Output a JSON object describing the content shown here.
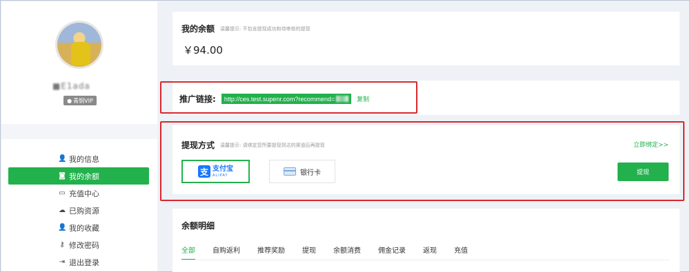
{
  "user": {
    "name": "■E1ada",
    "vip_label": "青铜VIP"
  },
  "sidebar": {
    "items": [
      {
        "label": "我的信息",
        "icon": "user-icon",
        "glyph": "👤"
      },
      {
        "label": "我的余额",
        "icon": "wallet-icon",
        "glyph": "◙",
        "active": true
      },
      {
        "label": "充值中心",
        "icon": "credit-card-icon",
        "glyph": "▭"
      },
      {
        "label": "已购资源",
        "icon": "cloud-download-icon",
        "glyph": "☁"
      },
      {
        "label": "我的收藏",
        "icon": "user-star-icon",
        "glyph": "👤"
      },
      {
        "label": "修改密码",
        "icon": "key-icon",
        "glyph": "⚷"
      },
      {
        "label": "退出登录",
        "icon": "logout-icon",
        "glyph": "⇥"
      }
    ]
  },
  "balance": {
    "title": "我的余额",
    "tip": "温馨提示: 不包含提现成功和待审核的提现",
    "amount": "￥94.00"
  },
  "promo": {
    "label": "推广链接:",
    "url": "http://ces.test.supenr.com?recommend=",
    "copy_label": "复制"
  },
  "withdraw": {
    "title": "提现方式",
    "tip": "温馨提示: 请绑定您所要提现到达的渠道后再提现",
    "bind_link": "立即绑定>>",
    "alipay_cn": "支付宝",
    "alipay_en": "ALIPAY",
    "bank_label": "银行卡",
    "button_label": "提现"
  },
  "details": {
    "title": "余额明细",
    "tabs": [
      "全部",
      "自购返利",
      "推荐奖励",
      "提现",
      "余额消费",
      "佣金记录",
      "返现",
      "充值"
    ],
    "active_tab": 0
  },
  "colors": {
    "accent": "#22b14c",
    "highlight_border": "#d9262c",
    "alipay_blue": "#1677ff"
  }
}
